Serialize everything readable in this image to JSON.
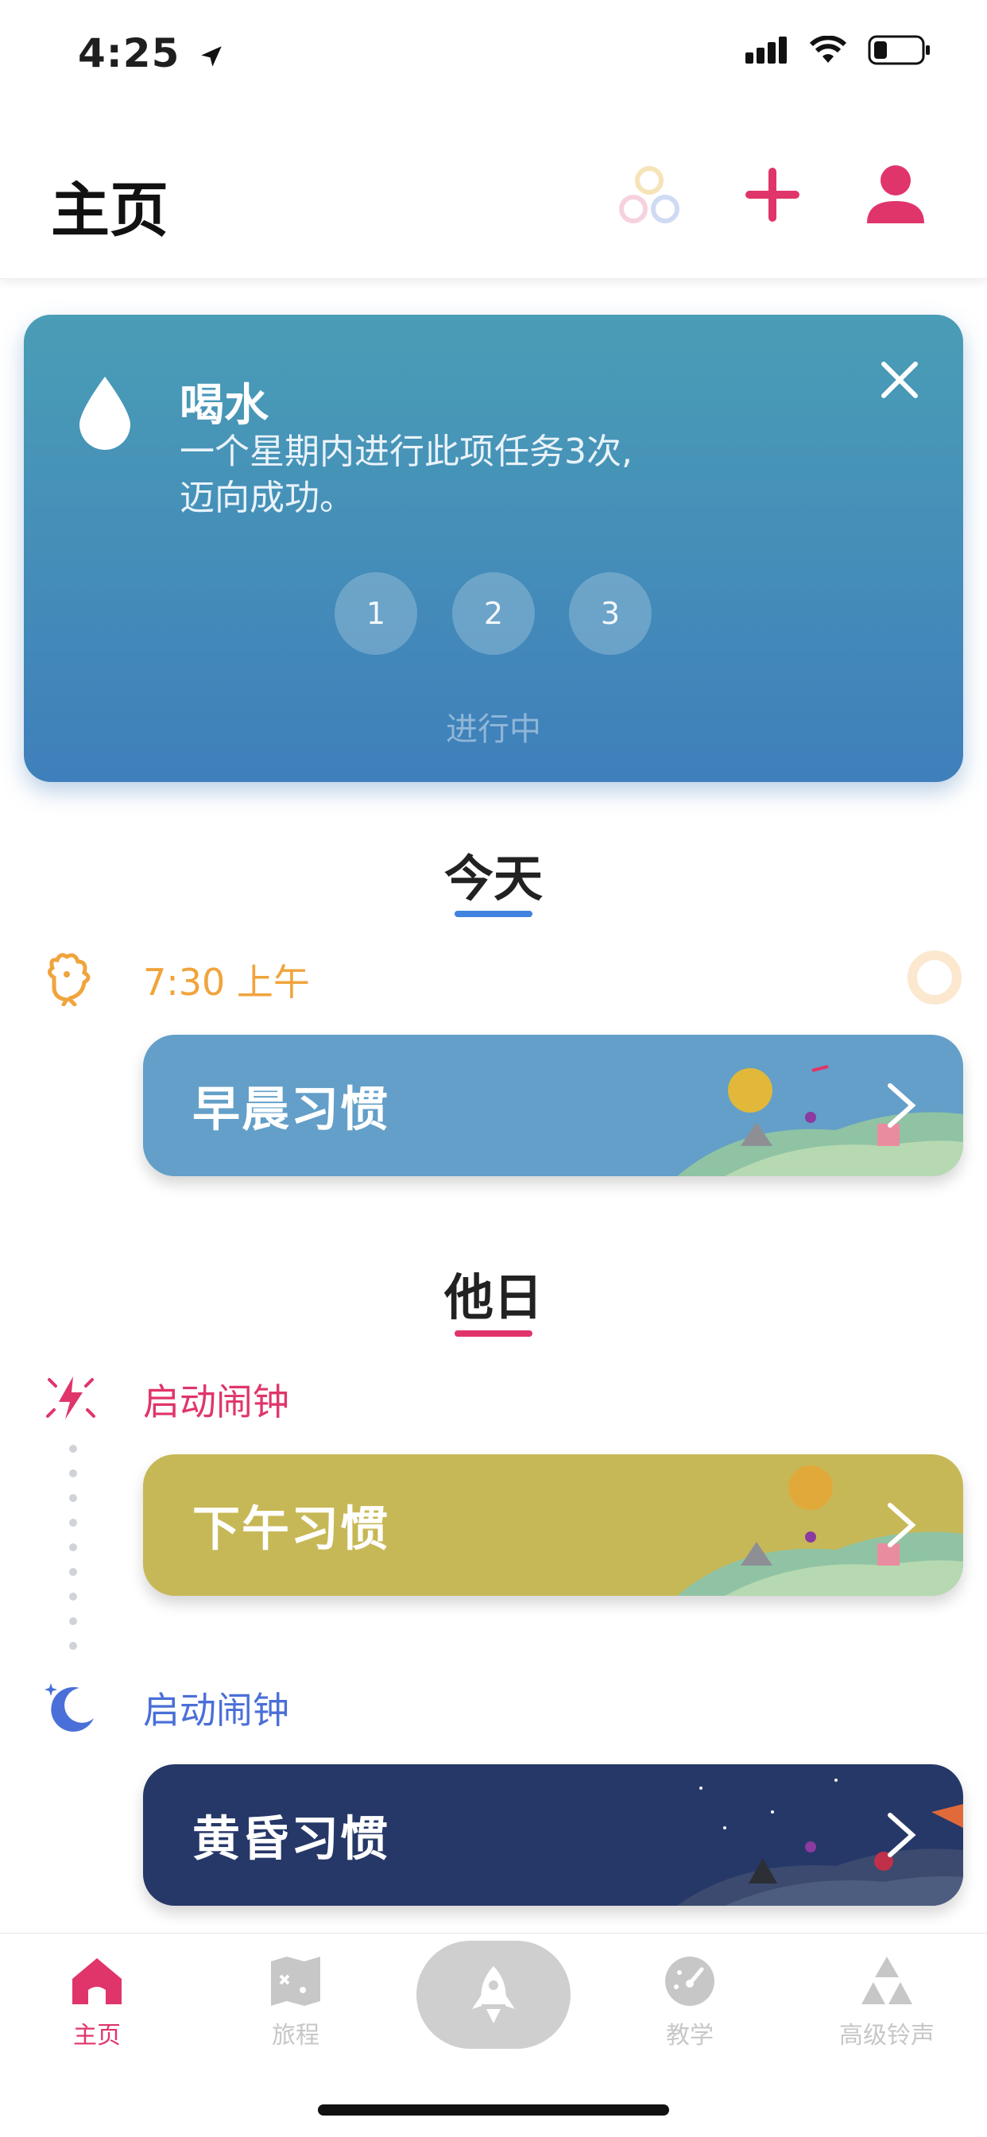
{
  "status_bar": {
    "time": "4:25"
  },
  "header": {
    "title": "主页"
  },
  "water_card": {
    "title": "喝水",
    "description_line1": "一个星期内进行此项任务3次,",
    "description_line2": "迈向成功。",
    "steps": [
      "1",
      "2",
      "3"
    ],
    "status": "进行中"
  },
  "sections": {
    "today": {
      "title": "今天",
      "accent": "#3f82e0"
    },
    "other": {
      "title": "他日",
      "accent": "#e0356a"
    }
  },
  "habits": {
    "morning": {
      "time": "7:30 上午",
      "label": "早晨习惯",
      "color": "#f0a43c",
      "bg": "#639fc8"
    },
    "afternoon": {
      "time": "启动闹钟",
      "label": "下午习惯",
      "color": "#e0356a",
      "bg": "#c7b857"
    },
    "evening": {
      "time": "启动闹钟",
      "label": "黄昏习惯",
      "color": "#4a6fd8",
      "bg": "#263868"
    }
  },
  "tabbar": {
    "home": "主页",
    "journey": "旅程",
    "teaching": "教学",
    "ringtones": "高级铃声"
  },
  "colors": {
    "brand_pink": "#e0356a",
    "inactive": "#c7c7c7"
  }
}
